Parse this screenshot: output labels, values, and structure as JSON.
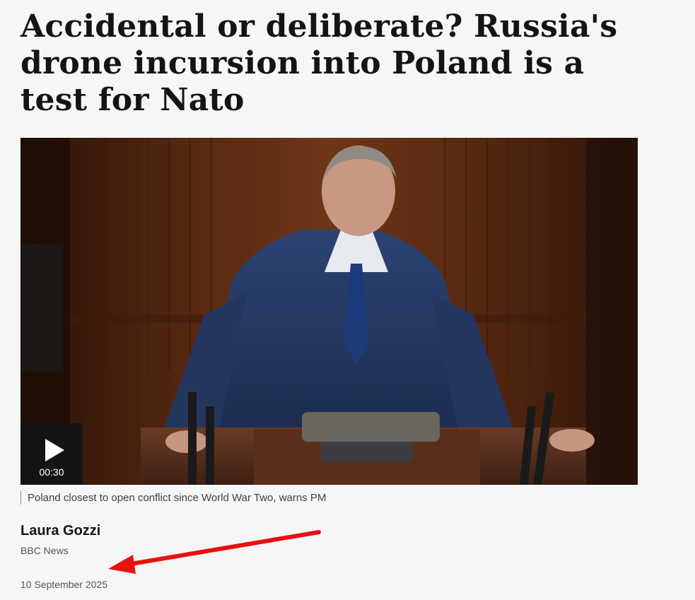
{
  "article": {
    "headline": "Accidental or deliberate? Russia's drone incursion into Poland is a test for Nato",
    "media": {
      "duration": "00:30",
      "caption": "Poland closest to open conflict since World War Two, warns PM"
    },
    "byline": {
      "author": "Laura Gozzi",
      "organisation": "BBC News",
      "date": "10 September 2025"
    }
  },
  "colors": {
    "background": "#f6f6f6",
    "text": "#141414",
    "muted_text": "#545658",
    "play_button": "#141414",
    "annotation_arrow": "#e8110f"
  }
}
